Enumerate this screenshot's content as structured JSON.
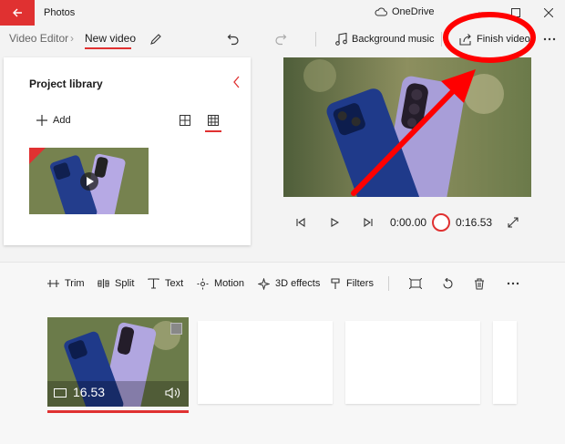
{
  "window": {
    "app_title": "Photos",
    "cloud_label": "OneDrive"
  },
  "toolbar": {
    "breadcrumb_root": "Video Editor",
    "breadcrumb_current": "New video",
    "background_music_label": "Background music",
    "finish_video_label": "Finish video"
  },
  "library": {
    "title": "Project library",
    "add_label": "Add"
  },
  "playback": {
    "current_time": "0:00.00",
    "total_time": "0:16.53"
  },
  "storyboard": {
    "tools": {
      "trim": "Trim",
      "split": "Split",
      "text": "Text",
      "motion": "Motion",
      "effects_3d": "3D effects",
      "filters": "Filters"
    },
    "clip": {
      "duration": "16.53"
    }
  },
  "colors": {
    "accent": "#e03131",
    "annotation": "#ff0000"
  }
}
